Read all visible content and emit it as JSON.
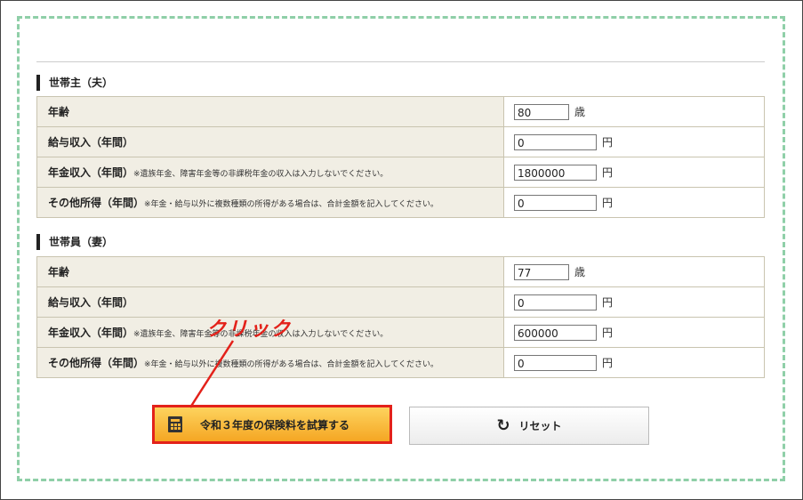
{
  "page": {
    "clipped_heading": "・・・・・・・・・"
  },
  "householder": {
    "heading": "世帯主（夫）",
    "rows": [
      {
        "label": "年齢",
        "note": "",
        "value": "80",
        "unit": "歳"
      },
      {
        "label": "給与収入（年間）",
        "note": "",
        "value": "0",
        "unit": "円"
      },
      {
        "label": "年金収入（年間）",
        "note": "※遺族年金、障害年金等の非課税年金の収入は入力しないでください。",
        "value": "1800000",
        "unit": "円"
      },
      {
        "label": "その他所得（年間）",
        "note": "※年金・給与以外に複数種類の所得がある場合は、合計金額を記入してください。",
        "value": "0",
        "unit": "円"
      }
    ]
  },
  "member": {
    "heading": "世帯員（妻）",
    "rows": [
      {
        "label": "年齢",
        "note": "",
        "value": "77",
        "unit": "歳"
      },
      {
        "label": "給与収入（年間）",
        "note": "",
        "value": "0",
        "unit": "円"
      },
      {
        "label": "年金収入（年間）",
        "note": "※遺族年金、障害年金等の非課税年金の収入は入力しないでください。",
        "value": "600000",
        "unit": "円"
      },
      {
        "label": "その他所得（年間）",
        "note": "※年金・給与以外に複数種類の所得がある場合は、合計金額を記入してください。",
        "value": "0",
        "unit": "円"
      }
    ]
  },
  "buttons": {
    "calculate_label": "令和３年度の保険料を試算する",
    "reset_label": "リセット"
  },
  "annotation": {
    "text": "クリック",
    "color": "#e3211a"
  },
  "icons": {
    "calculate": "calculator-icon",
    "reset": "reset-arrow-icon"
  },
  "colors": {
    "label_bg": "#f1eee4",
    "panel_border": "#8fcfa8",
    "calc_button": "#f5a623"
  }
}
